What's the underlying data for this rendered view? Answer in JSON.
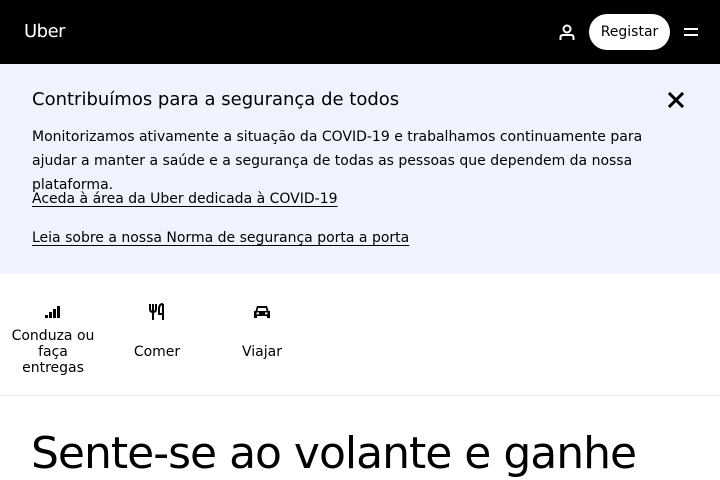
{
  "header": {
    "logo_text": "Uber",
    "account_icon": "user-icon",
    "register_label": "Registar",
    "menu_icon": "hamburger-menu-icon",
    "background_color": "#000000"
  },
  "banner": {
    "title": "Contribuímos para a segurança de todos",
    "close_icon": "close-icon",
    "body": "Monitorizamos ativamente a situação da COVID-19 e trabalhamos continuamente para ajudar a manter a saúde e a segurança de todas as pessoas que dependem da nossa plataforma.",
    "links": [
      {
        "label": "Aceda à área da Uber dedicada à COVID-19"
      },
      {
        "label": "Leia sobre a nossa Norma de segurança porta a porta"
      }
    ],
    "background_color": "#eff3fe"
  },
  "nav": {
    "tabs": [
      {
        "label": "Conduza ou faça entregas",
        "icon": "signal-bars-icon"
      },
      {
        "label": "Comer",
        "icon": "fork-knife-icon"
      },
      {
        "label": "Viajar",
        "icon": "car-icon"
      }
    ]
  },
  "hero": {
    "title": "Sente-se ao volante e ganhe"
  }
}
